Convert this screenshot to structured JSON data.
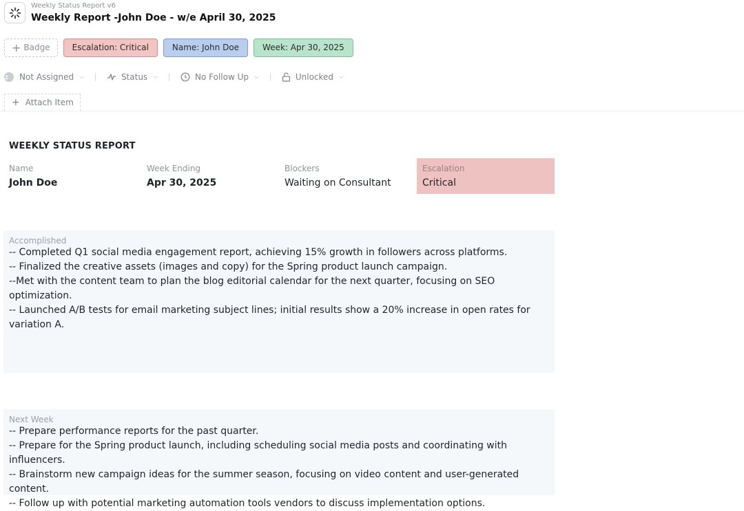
{
  "header": {
    "doc_type": "Weekly Status Report v6",
    "title": "Weekly Report -John Doe - w/e April 30, 2025",
    "icon": "spinner-icon"
  },
  "badges": {
    "add_label": "Badge",
    "items": [
      {
        "label": "Escalation: Critical",
        "color": "#f2c4c4"
      },
      {
        "label": "Name: John Doe",
        "color": "#b9cdef"
      },
      {
        "label": "Week: Apr 30, 2025",
        "color": "#b8e4cc"
      }
    ]
  },
  "properties": {
    "assignee": "Not Assigned",
    "status": "Status",
    "follow_up": "No Follow Up",
    "lock": "Unlocked"
  },
  "attach_label": "Attach Item",
  "report": {
    "title": "WEEKLY STATUS REPORT",
    "fields": [
      {
        "label": "Name",
        "value": "John Doe"
      },
      {
        "label": "Week Ending",
        "value": "Apr 30, 2025"
      },
      {
        "label": "Blockers",
        "value": "Waiting on Consultant"
      },
      {
        "label": "Escalation",
        "value": "Critical"
      }
    ],
    "accomplished": {
      "label": "Accomplished",
      "lines": [
        "-- Completed Q1 social media engagement report, achieving 15% growth in followers across platforms.",
        "-- Finalized the creative assets (images and copy) for the Spring product launch campaign.",
        "--Met with the content team to plan the blog editorial calendar for the next quarter, focusing on SEO optimization.",
        "-- Launched A/B tests for email marketing subject lines; initial results show a 20% increase in open rates for",
        "variation A."
      ]
    },
    "next_week": {
      "label": "Next Week",
      "lines": [
        "-- Prepare performance reports for the past quarter.",
        "-- Prepare for the Spring product launch, including scheduling social media posts and coordinating with influencers.",
        "-- Brainstorm new campaign ideas for the summer season, focusing on video content and user-generated content.",
        "-- Follow up with potential marketing automation tools vendors to discuss implementation options."
      ]
    }
  },
  "colors": {
    "escalation_highlight": "#efc2c2",
    "section_background": "#f5f8fa"
  }
}
